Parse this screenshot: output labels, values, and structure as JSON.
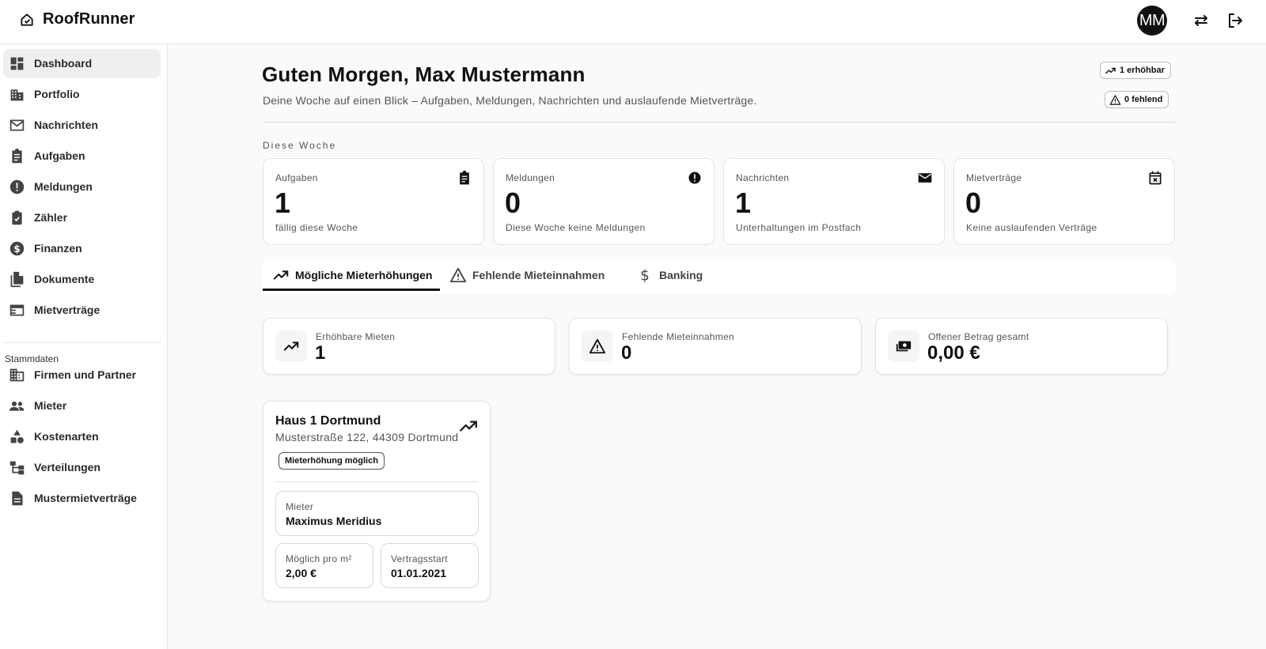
{
  "app": {
    "title": "RoofRunner"
  },
  "header": {
    "avatar_initials": "MM",
    "switch_icon": "swap-icon",
    "logout_icon": "logout-icon"
  },
  "sidebar": {
    "items": [
      {
        "label": "Dashboard",
        "icon": "dashboard-icon",
        "active": true
      },
      {
        "label": "Portfolio",
        "icon": "building-icon"
      },
      {
        "label": "Nachrichten",
        "icon": "mail-icon"
      },
      {
        "label": "Aufgaben",
        "icon": "clipboard-icon"
      },
      {
        "label": "Meldungen",
        "icon": "alert-circle-icon"
      },
      {
        "label": "Zähler",
        "icon": "meter-icon"
      },
      {
        "label": "Finanzen",
        "icon": "dollar-icon"
      },
      {
        "label": "Dokumente",
        "icon": "documents-icon"
      },
      {
        "label": "Mietverträge",
        "icon": "contract-icon"
      }
    ],
    "section_title": "Stammdaten",
    "master_items": [
      {
        "label": "Firmen und Partner",
        "icon": "company-icon"
      },
      {
        "label": "Mieter",
        "icon": "people-icon"
      },
      {
        "label": "Kostenarten",
        "icon": "category-icon"
      },
      {
        "label": "Verteilungen",
        "icon": "distribution-icon"
      },
      {
        "label": "Mustermietverträge",
        "icon": "template-icon"
      }
    ]
  },
  "main": {
    "greeting": "Guten Morgen, Max Mustermann",
    "subline": "Deine Woche auf einen Blick – Aufgaben, Meldungen, Nachrichten und auslaufende Mietverträge.",
    "chips": {
      "increasable": "1 erhöhbar",
      "missing": "0 fehlend"
    },
    "week_label": "Diese Woche",
    "stats": [
      {
        "title": "Aufgaben",
        "value": "1",
        "sub": "fällig diese Woche",
        "icon": "clipboard-icon"
      },
      {
        "title": "Meldungen",
        "value": "0",
        "sub": "Diese Woche keine Meldungen",
        "icon": "alert-circle-icon"
      },
      {
        "title": "Nachrichten",
        "value": "1",
        "sub": "Unterhaltungen im Postfach",
        "icon": "mail-icon"
      },
      {
        "title": "Mietverträge",
        "value": "0",
        "sub": "Keine auslaufenden Verträge",
        "icon": "calendar-x-icon"
      }
    ],
    "tabs": [
      {
        "label": "Mögliche Mieterhöhungen",
        "icon": "trending-up-icon",
        "active": true
      },
      {
        "label": "Fehlende Mieteinnahmen",
        "icon": "warning-icon"
      },
      {
        "label": "Banking",
        "icon": "dollar-icon"
      }
    ],
    "summary": [
      {
        "title": "Erhöhbare Mieten",
        "value": "1",
        "icon": "trending-up-icon"
      },
      {
        "title": "Fehlende Mieteinnahmen",
        "value": "0",
        "icon": "warning-icon"
      },
      {
        "title": "Offener Betrag gesamt",
        "value": "0,00 €",
        "icon": "money-icon"
      }
    ],
    "property": {
      "name": "Haus 1 Dortmund",
      "address": "Musterstraße 122, 44309 Dortmund",
      "badge": "Mieterhöhung möglich",
      "tenant_label": "Mieter",
      "tenant_name": "Maximus Meridius",
      "possible_label": "Möglich pro m²",
      "possible_value": "2,00 €",
      "start_label": "Vertragsstart",
      "start_value": "01.01.2021"
    }
  },
  "colors": {
    "active_nav": "#efefef",
    "text": "#111111",
    "muted": "#555555",
    "border": "#e3e3e3"
  }
}
